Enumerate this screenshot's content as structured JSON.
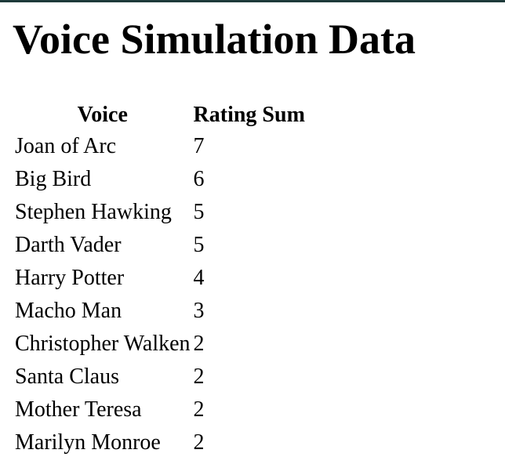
{
  "page": {
    "title": "Voice Simulation Data"
  },
  "table": {
    "headers": [
      "Voice",
      "Rating Sum"
    ],
    "rows": [
      {
        "voice": "Joan of Arc",
        "rating_sum": "7"
      },
      {
        "voice": "Big Bird",
        "rating_sum": "6"
      },
      {
        "voice": "Stephen Hawking",
        "rating_sum": "5"
      },
      {
        "voice": "Darth Vader",
        "rating_sum": "5"
      },
      {
        "voice": "Harry Potter",
        "rating_sum": "4"
      },
      {
        "voice": "Macho Man",
        "rating_sum": "3"
      },
      {
        "voice": "Christopher Walken",
        "rating_sum": "2"
      },
      {
        "voice": "Santa Claus",
        "rating_sum": "2"
      },
      {
        "voice": "Mother Teresa",
        "rating_sum": "2"
      },
      {
        "voice": "Marilyn Monroe",
        "rating_sum": "2"
      }
    ]
  },
  "colors": {
    "text": "#000000",
    "background": "#ffffff",
    "top_border": "#1e3a3a"
  }
}
